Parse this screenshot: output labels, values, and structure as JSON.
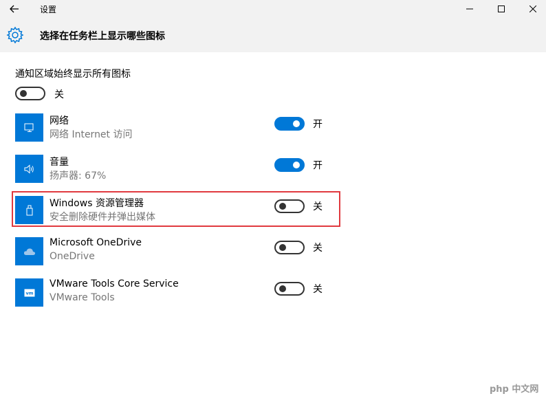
{
  "window": {
    "app_title": "设置"
  },
  "header": {
    "title": "选择在任务栏上显示哪些图标"
  },
  "always_show": {
    "label": "通知区域始终显示所有图标",
    "state_label": "关",
    "on": false
  },
  "rows": [
    {
      "name": "网络",
      "desc": "网络 Internet 访问",
      "state_label": "开",
      "on": true,
      "icon": "network-icon"
    },
    {
      "name": "音量",
      "desc": "扬声器: 67%",
      "state_label": "开",
      "on": true,
      "icon": "speaker-icon"
    },
    {
      "name": "Windows 资源管理器",
      "desc": "安全删除硬件并弹出媒体",
      "state_label": "关",
      "on": false,
      "icon": "usb-drive-icon"
    },
    {
      "name": "Microsoft OneDrive",
      "desc": "OneDrive",
      "state_label": "关",
      "on": false,
      "icon": "cloud-icon"
    },
    {
      "name": "VMware Tools Core Service",
      "desc": "VMware Tools",
      "state_label": "关",
      "on": false,
      "icon": "vmware-icon"
    }
  ],
  "watermark": "php 中文网",
  "colors": {
    "accent": "#0078d7",
    "highlight_border": "#e0393e",
    "header_bg": "#f2f2f2"
  }
}
